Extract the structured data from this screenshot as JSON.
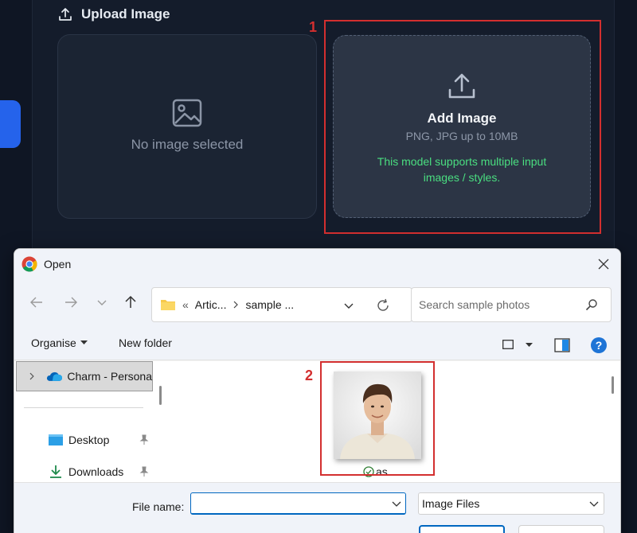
{
  "app": {
    "upload_heading": "Upload Image",
    "empty_preview_text": "No image selected",
    "add_image_title": "Add Image",
    "add_image_formats": "PNG, JPG up to 10MB",
    "add_image_note": "This model supports multiple input images / styles.",
    "step_1": "1",
    "step_2": "2",
    "accent_color": "#2563eb",
    "note_color": "#4ade80",
    "highlight_color": "#d32f2f"
  },
  "dialog": {
    "title": "Open",
    "address": {
      "prefix": "«",
      "crumbs": [
        "Artic...",
        "sample ..."
      ]
    },
    "search_placeholder": "Search sample photos",
    "commands": {
      "organise": "Organise",
      "new_folder": "New folder"
    },
    "nav": {
      "selected": "Charm - Persona",
      "items": [
        "Desktop",
        "Downloads"
      ]
    },
    "file": {
      "name": "as",
      "status": "synced"
    },
    "file_name_label": "File name:",
    "file_name_value": "",
    "file_type": "Image Files"
  }
}
